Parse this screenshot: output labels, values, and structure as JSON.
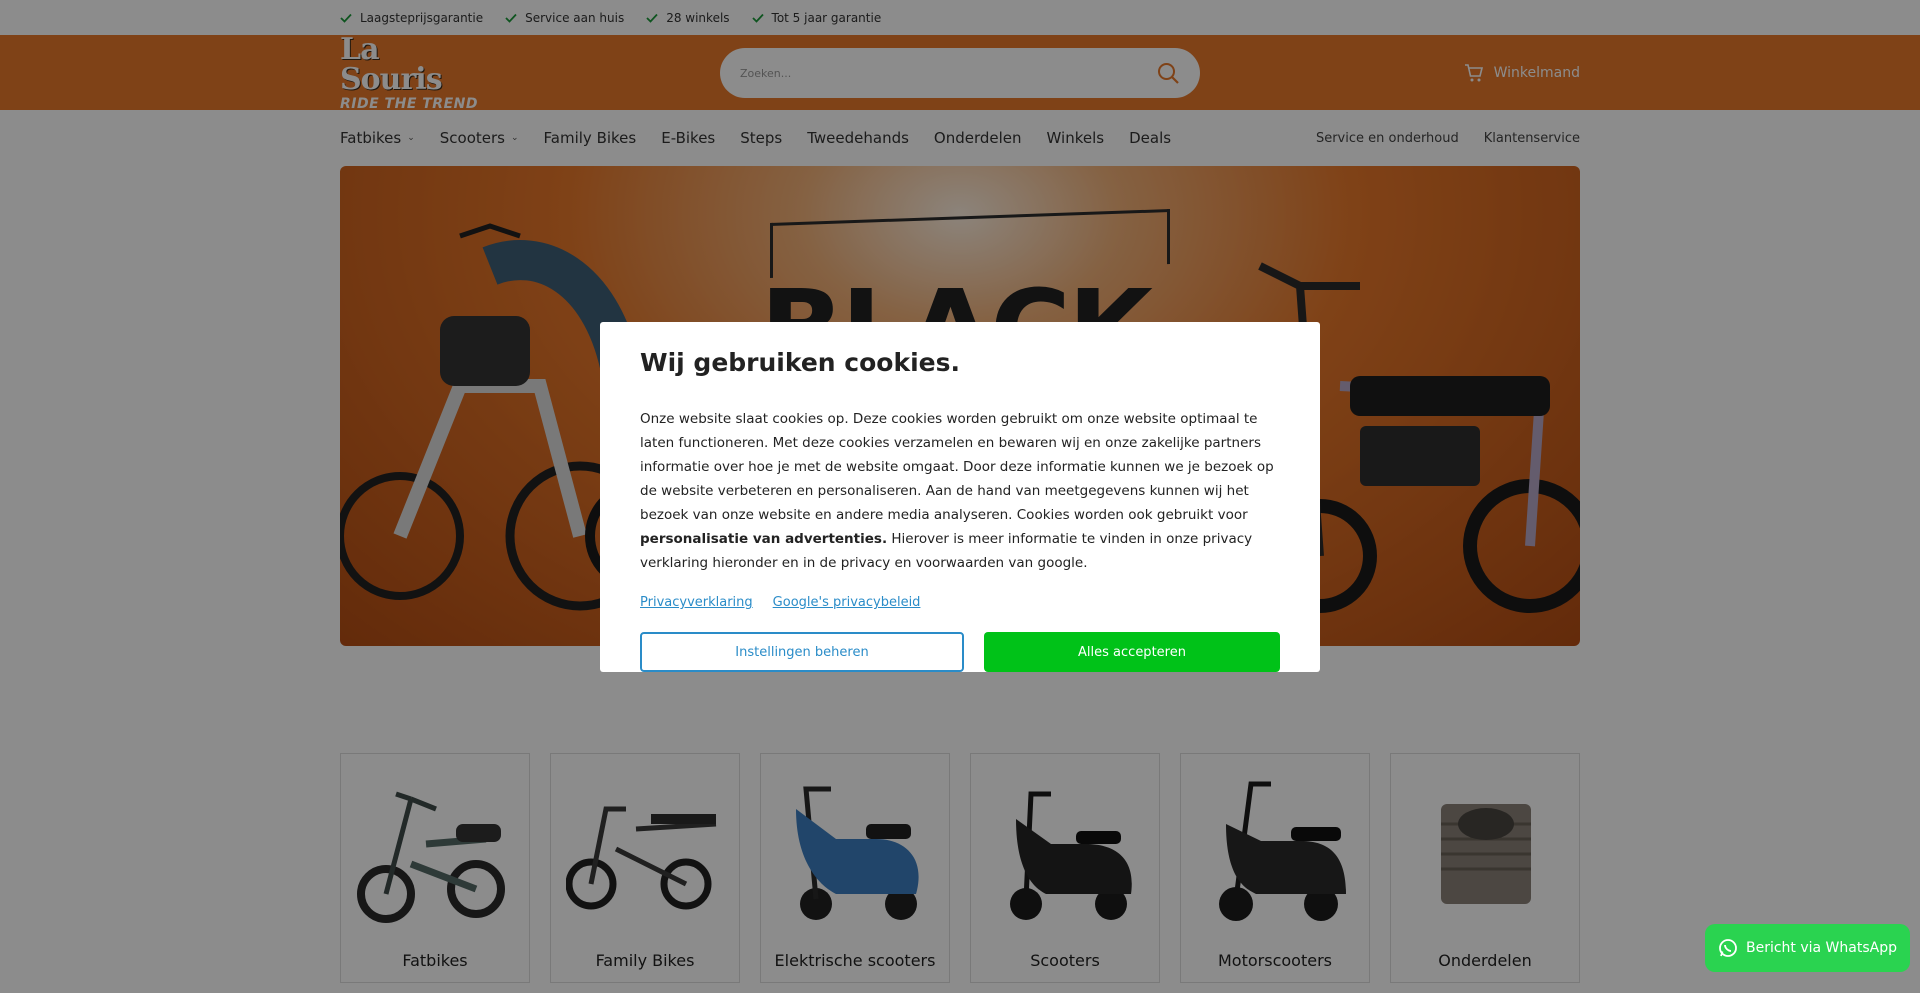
{
  "usp": [
    {
      "label": "Laagsteprijsgarantie"
    },
    {
      "label": "Service aan huis"
    },
    {
      "label": "28 winkels"
    },
    {
      "label": "Tot 5 jaar garantie"
    }
  ],
  "header": {
    "logo_main": "La Souris",
    "logo_tagline": "RIDE THE TREND",
    "search_placeholder": "Zoeken...",
    "cart_label": "Winkelmand"
  },
  "nav": {
    "items": [
      {
        "label": "Fatbikes",
        "dropdown": true
      },
      {
        "label": "Scooters",
        "dropdown": true
      },
      {
        "label": "Family Bikes"
      },
      {
        "label": "E-Bikes"
      },
      {
        "label": "Steps"
      },
      {
        "label": "Tweedehands"
      },
      {
        "label": "Onderdelen"
      },
      {
        "label": "Winkels"
      },
      {
        "label": "Deals"
      }
    ],
    "secondary": [
      {
        "label": "Service en onderhoud"
      },
      {
        "label": "Klantenservice"
      }
    ]
  },
  "hero": {
    "text": "BLACK"
  },
  "cookie": {
    "title": "Wij gebruiken cookies.",
    "body_1": "Onze website slaat cookies op. Deze cookies worden gebruikt om onze website optimaal te laten functioneren. Met deze cookies verzamelen en bewaren wij en onze zakelijke partners informatie over hoe je met de website omgaat. Door deze informatie kunnen we je bezoek op de website verbeteren en personaliseren. Aan de hand van meetgegevens kunnen wij het bezoek van onze website en andere media analyseren. Cookies worden ook gebruikt voor ",
    "body_bold": "personalisatie van advertenties.",
    "body_2": " Hierover is meer informatie te vinden in onze privacy verklaring hieronder en in de privacy en voorwaarden van google.",
    "link_privacy": "Privacyverklaring",
    "link_google": "Google's privacybeleid",
    "btn_settings": "Instellingen beheren",
    "btn_accept": "Alles accepteren"
  },
  "categories": [
    {
      "label": "Fatbikes"
    },
    {
      "label": "Family Bikes"
    },
    {
      "label": "Elektrische scooters"
    },
    {
      "label": "Scooters"
    },
    {
      "label": "Motorscooters"
    },
    {
      "label": "Onderdelen"
    }
  ],
  "whatsapp": {
    "label": "Bericht via WhatsApp"
  },
  "colors": {
    "brand_orange": "#e8782a",
    "accept_green": "#00c218",
    "link_blue": "#2a8cc8",
    "whatsapp_green": "#2ad350"
  }
}
